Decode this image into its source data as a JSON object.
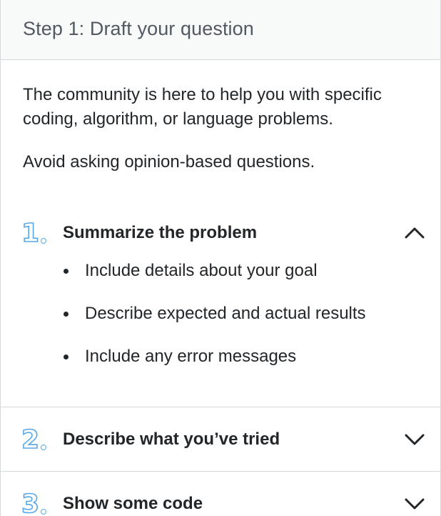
{
  "header": {
    "title": "Step 1: Draft your question"
  },
  "intro": {
    "paragraph1": "The community is here to help you with specific coding, algorithm, or language problems.",
    "paragraph2": "Avoid asking opinion-based questions."
  },
  "sections": [
    {
      "number": "1",
      "title": "Summarize the problem",
      "expanded": true,
      "chevron_icon": "chevron-up-icon",
      "items": [
        "Include details about your goal",
        "Describe expected and actual results",
        "Include any error messages"
      ]
    },
    {
      "number": "2",
      "title": "Describe what you’ve tried",
      "expanded": false,
      "chevron_icon": "chevron-down-icon"
    },
    {
      "number": "3",
      "title": "Show some code",
      "expanded": false,
      "chevron_icon": "chevron-down-icon"
    }
  ],
  "colors": {
    "number_accent": "#59a8e6",
    "header_bg": "#f8f9f9",
    "divider": "#d6d9dc",
    "text": "#232629",
    "header_text": "#525960"
  }
}
